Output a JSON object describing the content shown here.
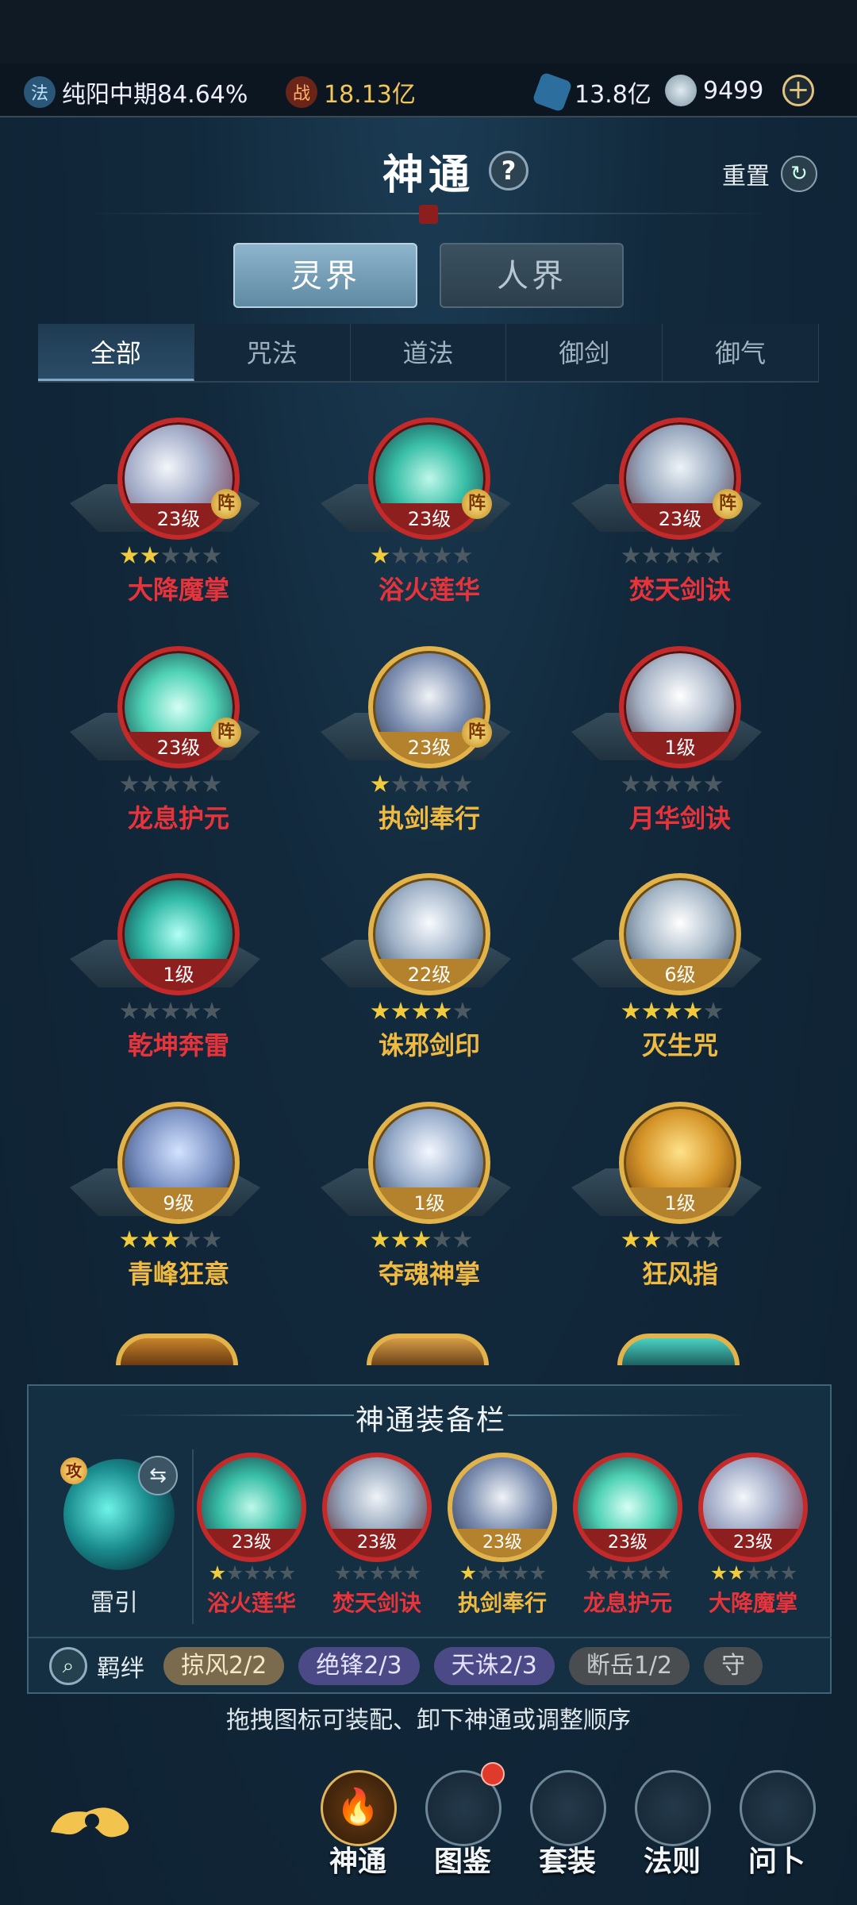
{
  "topbar": {
    "cultivation_icon": "法",
    "cultivation": "纯阳中期84.64%",
    "power_icon": "战",
    "power": "18.13亿",
    "spirit_stone": "13.8亿",
    "jade": "9499",
    "plus": "+"
  },
  "header": {
    "title": "神通",
    "help": "?",
    "reset": "重置"
  },
  "realm_tabs": [
    "灵界",
    "人界"
  ],
  "category_tabs": [
    "全部",
    "咒法",
    "道法",
    "御剑",
    "御气"
  ],
  "badge_zhen": "阵",
  "skills": [
    {
      "name": "大降魔掌",
      "level": "23级",
      "stars": 2,
      "ring": "red",
      "zhen": true
    },
    {
      "name": "浴火莲华",
      "level": "23级",
      "stars": 1,
      "ring": "red",
      "zhen": true
    },
    {
      "name": "焚天剑诀",
      "level": "23级",
      "stars": 0,
      "ring": "red",
      "zhen": true
    },
    {
      "name": "龙息护元",
      "level": "23级",
      "stars": 0,
      "ring": "red",
      "zhen": true
    },
    {
      "name": "执剑奉行",
      "level": "23级",
      "stars": 1,
      "ring": "gold",
      "zhen": true
    },
    {
      "name": "月华剑诀",
      "level": "1级",
      "stars": 0,
      "ring": "red",
      "zhen": false
    },
    {
      "name": "乾坤奔雷",
      "level": "1级",
      "stars": 0,
      "ring": "red",
      "zhen": false
    },
    {
      "name": "诛邪剑印",
      "level": "22级",
      "stars": 4,
      "ring": "gold",
      "zhen": false
    },
    {
      "name": "灭生咒",
      "level": "6级",
      "stars": 4,
      "ring": "gold",
      "zhen": false
    },
    {
      "name": "青峰狂意",
      "level": "9级",
      "stars": 3,
      "ring": "gold",
      "zhen": false
    },
    {
      "name": "夺魂神掌",
      "level": "1级",
      "stars": 3,
      "ring": "gold",
      "zhen": false
    },
    {
      "name": "狂风指",
      "level": "1级",
      "stars": 2,
      "ring": "gold",
      "zhen": false
    }
  ],
  "equip": {
    "title": "神通装备栏",
    "attack_badge": "攻",
    "swap": "⇆",
    "main_skill": "雷引",
    "slots": [
      {
        "name": "浴火莲华",
        "level": "23级",
        "stars": 1,
        "ring": "red"
      },
      {
        "name": "焚天剑诀",
        "level": "23级",
        "stars": 0,
        "ring": "red"
      },
      {
        "name": "执剑奉行",
        "level": "23级",
        "stars": 1,
        "ring": "gold"
      },
      {
        "name": "龙息护元",
        "level": "23级",
        "stars": 0,
        "ring": "red"
      },
      {
        "name": "大降魔掌",
        "level": "23级",
        "stars": 2,
        "ring": "red"
      }
    ],
    "bond_label": "羁绊",
    "bonds": [
      "掠风2/2",
      "绝锋2/3",
      "天诛2/3",
      "断岳1/2",
      "守"
    ]
  },
  "hint": "拖拽图标可装配、卸下神通或调整顺序",
  "nav": [
    "神通",
    "图鉴",
    "套装",
    "法则",
    "问卜"
  ],
  "colors": {
    "red_ring": "#c52a2a",
    "gold_ring": "#e2b34a",
    "red_name": "#e8333b",
    "gold_name": "#f0b940"
  }
}
